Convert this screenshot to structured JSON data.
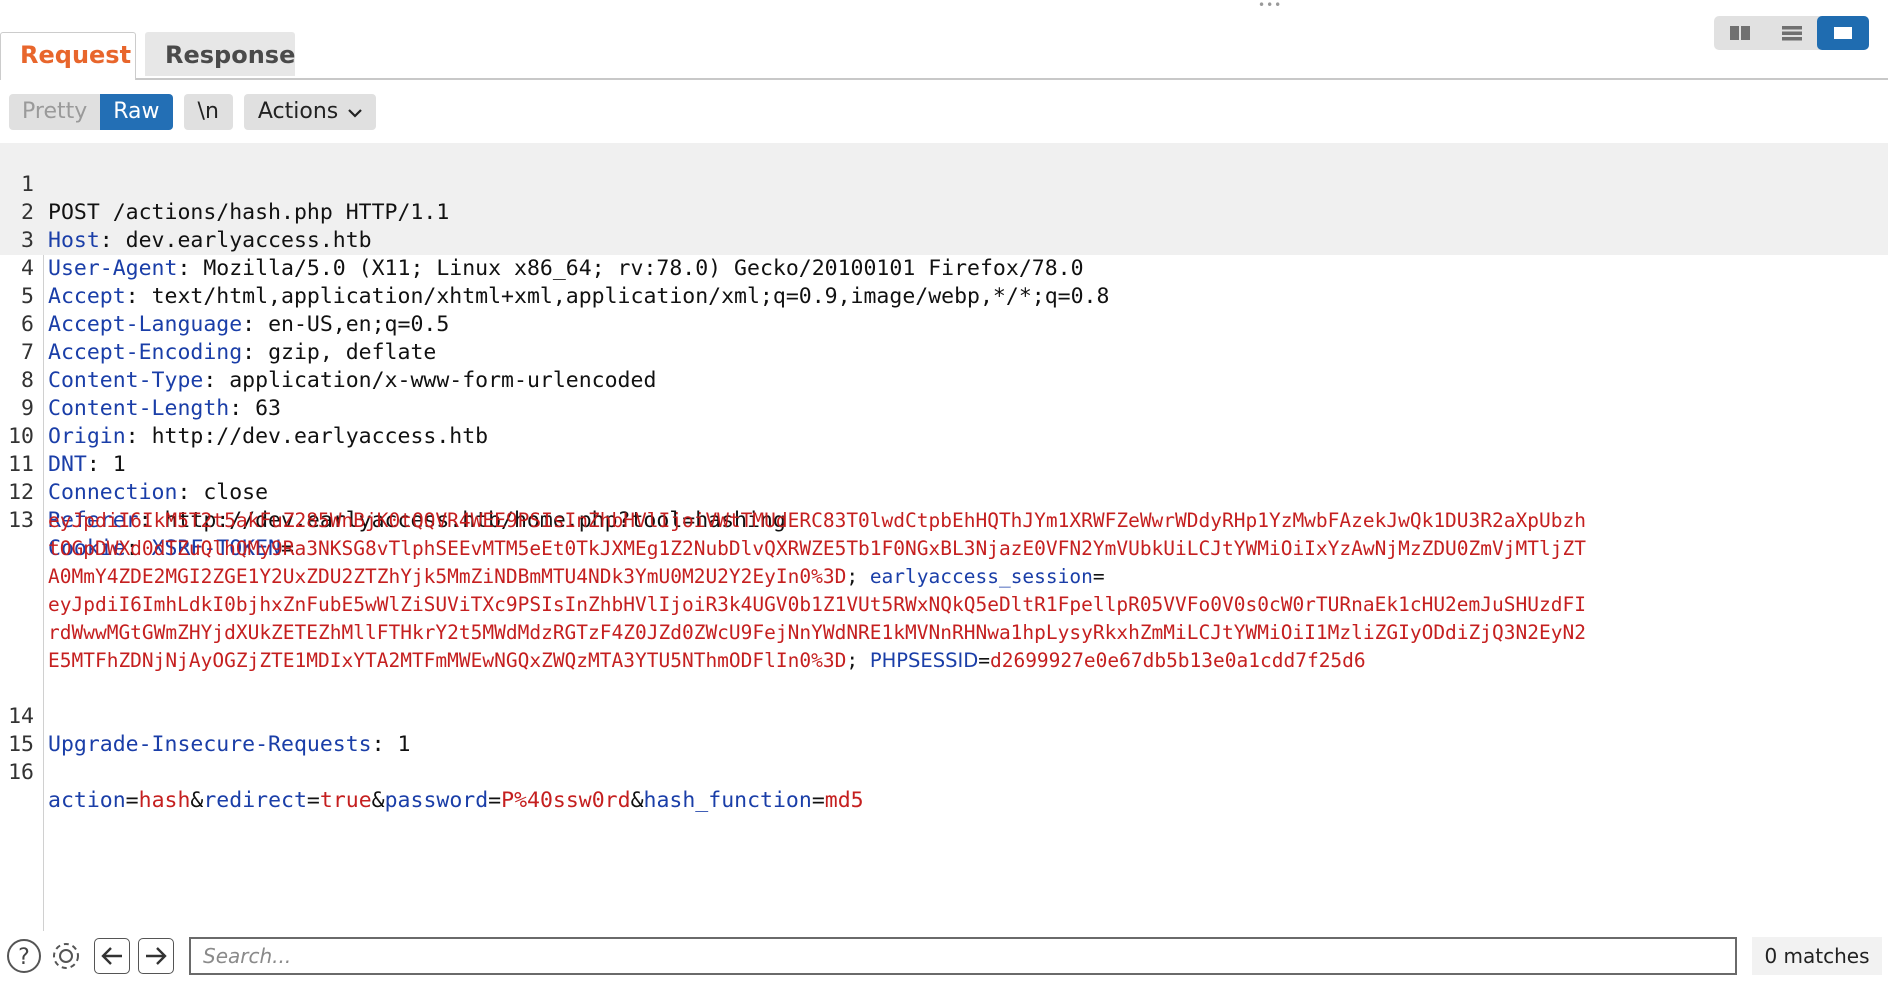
{
  "tabs": {
    "request": "Request",
    "response": "Response"
  },
  "toolbar": {
    "pretty": "Pretty",
    "raw": "Raw",
    "newline": "\\n",
    "actions": "Actions"
  },
  "lines": [
    {
      "n": "1",
      "key": "POST /actions/hash.php HTTP/1.1",
      "sep": "",
      "val": ""
    },
    {
      "n": "2",
      "key": "Host",
      "sep": ": ",
      "val": "dev.earlyaccess.htb"
    },
    {
      "n": "3",
      "key": "User-Agent",
      "sep": ": ",
      "val": "Mozilla/5.0 (X11; Linux x86_64; rv:78.0) Gecko/20100101 Firefox/78.0"
    },
    {
      "n": "4",
      "key": "Accept",
      "sep": ": ",
      "val": "text/html,application/xhtml+xml,application/xml;q=0.9,image/webp,*/*;q=0.8"
    },
    {
      "n": "5",
      "key": "Accept-Language",
      "sep": ": ",
      "val": "en-US,en;q=0.5"
    },
    {
      "n": "6",
      "key": "Accept-Encoding",
      "sep": ": ",
      "val": "gzip, deflate"
    },
    {
      "n": "7",
      "key": "Content-Type",
      "sep": ": ",
      "val": "application/x-www-form-urlencoded"
    },
    {
      "n": "8",
      "key": "Content-Length",
      "sep": ": ",
      "val": "63"
    },
    {
      "n": "9",
      "key": "Origin",
      "sep": ": ",
      "val": "http://dev.earlyaccess.htb"
    },
    {
      "n": "10",
      "key": "DNT",
      "sep": ": ",
      "val": "1"
    },
    {
      "n": "11",
      "key": "Connection",
      "sep": ": ",
      "val": "close"
    },
    {
      "n": "12",
      "key": "Referer",
      "sep": ": ",
      "val": "http://dev.earlyaccess.htb/home.php?tool=hashing"
    }
  ],
  "cookie": {
    "n": "13",
    "key": "Cookie",
    "xsrf_name": "XSRF-TOKEN",
    "xsrf_lines": [
      "eyJpdiI6IkM5T2t5akFuZ285WnBjK0tQQVR4WEE9PSIsInZhbHVlIjoiVWtTMUdERC83T0lwdCtpbEhHQThJYm1XRWFZeWwrWDdyRHp1YzMwbFAzekJwQk1DU3R2aXpUbzh",
      "tOGpDWXd0dTZuQlhQMy9Ra3NKSG8vTlphSEEvMTM5eEt0TkJXMEg1Z2NubDlvQXRWZE5Tb1F0NGxBL3NjazE0VFN2YmVUbkUiLCJtYWMiOiIxYzAwNjMzZDU0ZmVjMTljZT",
      "A0MmY4ZDE2MGI2ZGE1Y2UxZDU2ZTZhYjk5MmZiNDBmMTU4NDk3YmU0M2U2Y2EyIn0%3D"
    ],
    "session_name": "earlyaccess_session",
    "session_lines": [
      "eyJpdiI6ImhLdkI0bjhxZnFubE5wWlZiSUViTXc9PSIsInZhbHVlIjoiR3k4UGV0b1Z1VUt5RWxNQkQ5eDltR1FpellpR05VVFo0V0s0cW0rTURnaEk1cHU2emJuSHUzdFI",
      "rdWwwMGtGWmZHYjdXUkZETEZhMllFTHkrY2t5MWdMdzRGTzF4Z0JZd0ZWcU9FejNnYWdNRE1kMVNnRHNwa1hpLysyRkxhZmMiLCJtYWMiOiI1MzliZGIyODdiZjQ3N2EyN2",
      "E5MTFhZDNjNjAyOGZjZTE1MDIxYTA2MTFmMWEwNGQxZWQzMTA3YTU5NThmODFlIn0%3D"
    ],
    "php_name": "PHPSESSID",
    "php_val": "d2699927e0e67db5b13e0a1cdd7f25d6"
  },
  "line14": {
    "n": "14",
    "key": "Upgrade-Insecure-Requests",
    "sep": ": ",
    "val": "1"
  },
  "line15": {
    "n": "15"
  },
  "body": {
    "n": "16",
    "p1k": "action",
    "p1v": "hash",
    "p2k": "redirect",
    "p2v": "true",
    "p3k": "password",
    "p3v": "P%40ssw0rd",
    "p4k": "hash_function",
    "p4v": "md5"
  },
  "search": {
    "placeholder": "Search...",
    "matches": "0 matches"
  },
  "icons": [
    "help-icon",
    "settings-icon",
    "arrow-left-icon",
    "arrow-right-icon"
  ]
}
